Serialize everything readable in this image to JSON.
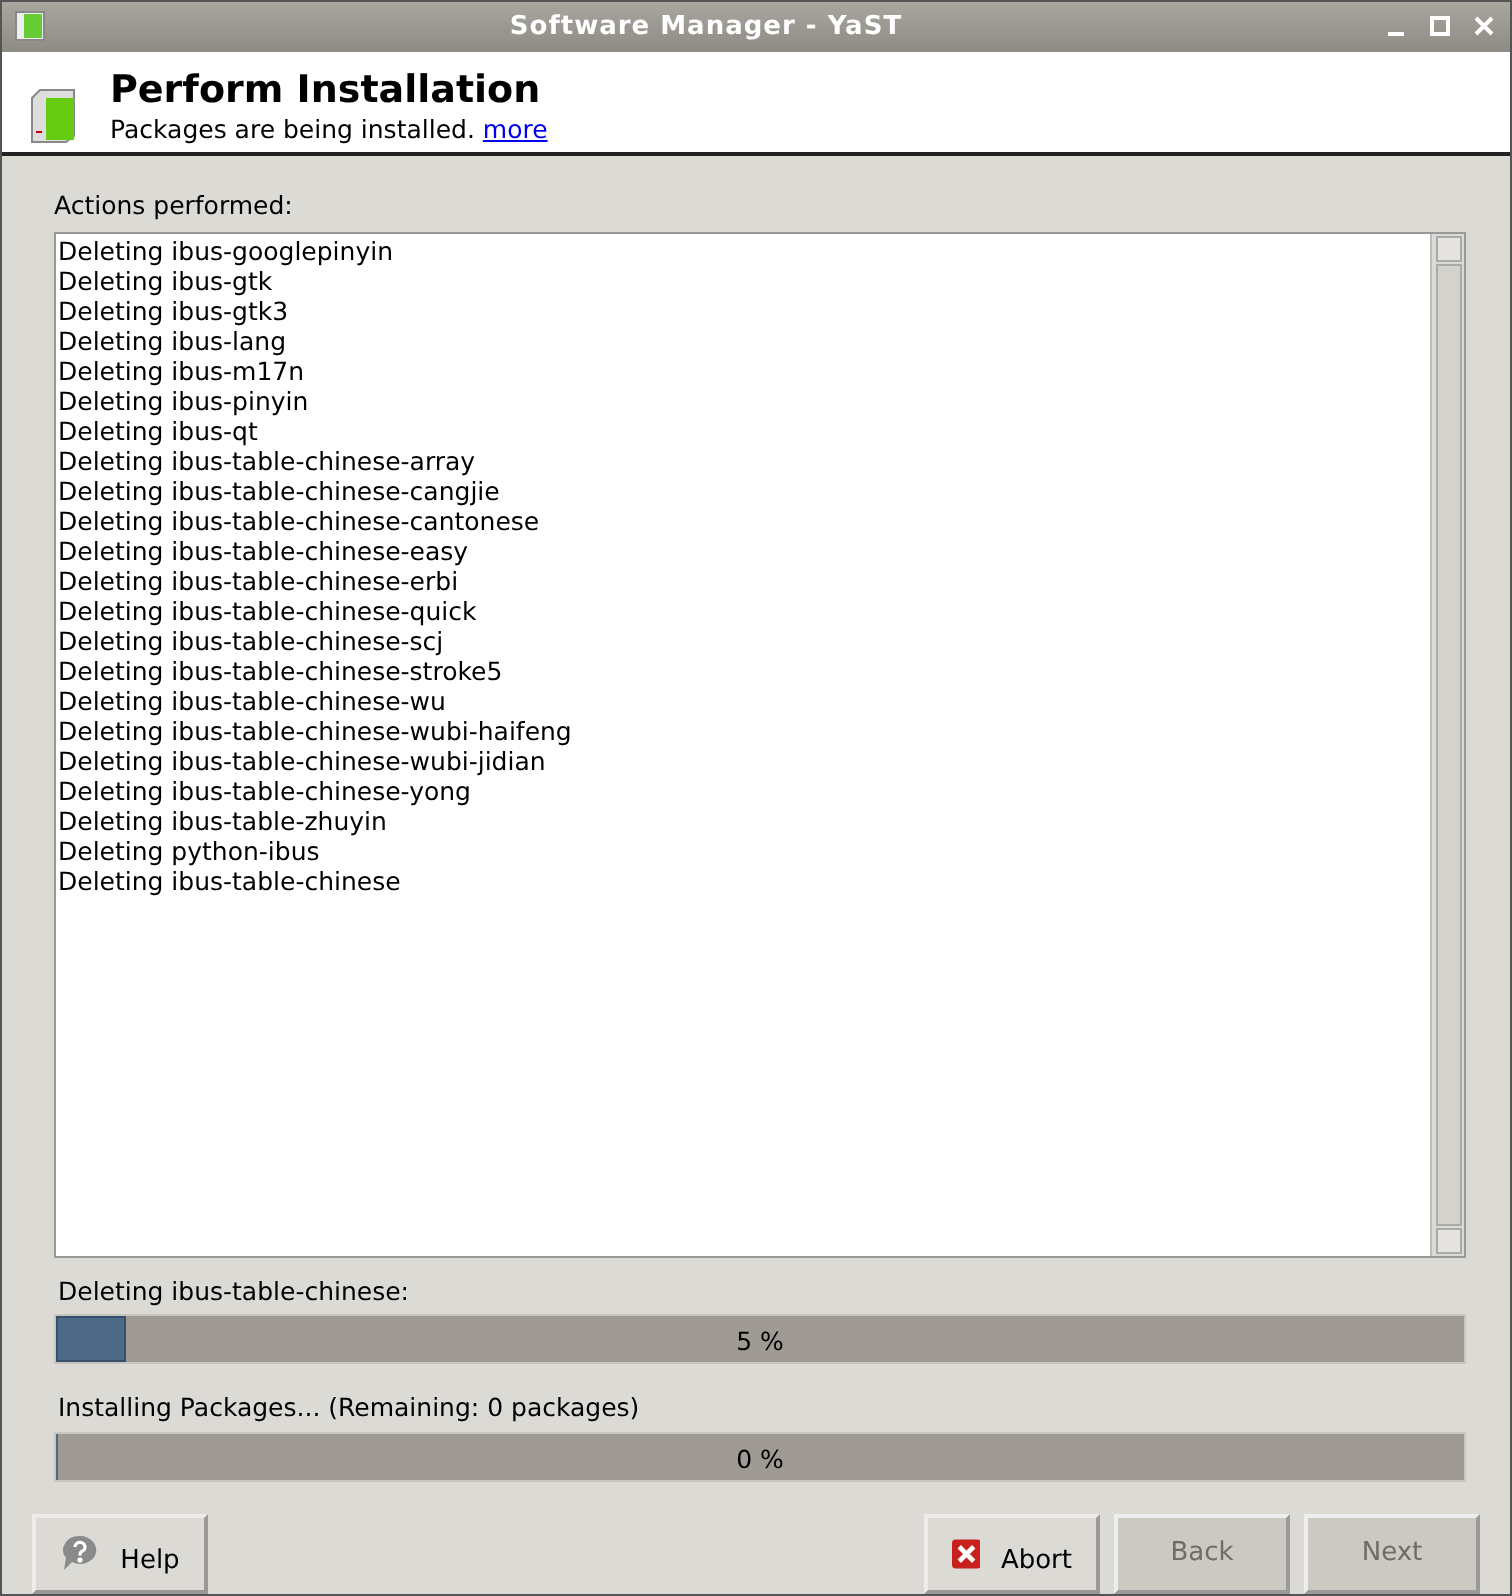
{
  "window": {
    "title": "Software Manager - YaST"
  },
  "header": {
    "title": "Perform Installation",
    "subtitle": "Packages are being installed.",
    "link": "more"
  },
  "log": {
    "label": "Actions performed:",
    "lines": [
      "Deleting ibus-googlepinyin",
      "Deleting ibus-gtk",
      "Deleting ibus-gtk3",
      "Deleting ibus-lang",
      "Deleting ibus-m17n",
      "Deleting ibus-pinyin",
      "Deleting ibus-qt",
      "Deleting ibus-table-chinese-array",
      "Deleting ibus-table-chinese-cangjie",
      "Deleting ibus-table-chinese-cantonese",
      "Deleting ibus-table-chinese-easy",
      "Deleting ibus-table-chinese-erbi",
      "Deleting ibus-table-chinese-quick",
      "Deleting ibus-table-chinese-scj",
      "Deleting ibus-table-chinese-stroke5",
      "Deleting ibus-table-chinese-wu",
      "Deleting ibus-table-chinese-wubi-haifeng",
      "Deleting ibus-table-chinese-wubi-jidian",
      "Deleting ibus-table-chinese-yong",
      "Deleting ibus-table-zhuyin",
      "Deleting python-ibus",
      "Deleting ibus-table-chinese"
    ]
  },
  "progress": [
    {
      "label": "Deleting ibus-table-chinese:",
      "level": 0.05,
      "reading": "5 %"
    },
    {
      "label": "Installing Packages... (Remaining: 0 packages)",
      "level": 0,
      "reading": "0 %"
    }
  ],
  "buttons": [
    {
      "kind": "help",
      "label": "Help",
      "disabled": false
    },
    {
      "kind": "abort",
      "label": "Abort",
      "disabled": false
    },
    {
      "kind": "plain",
      "label": "Back",
      "disabled": true
    },
    {
      "kind": "plain",
      "label": "Next",
      "disabled": true
    }
  ]
}
